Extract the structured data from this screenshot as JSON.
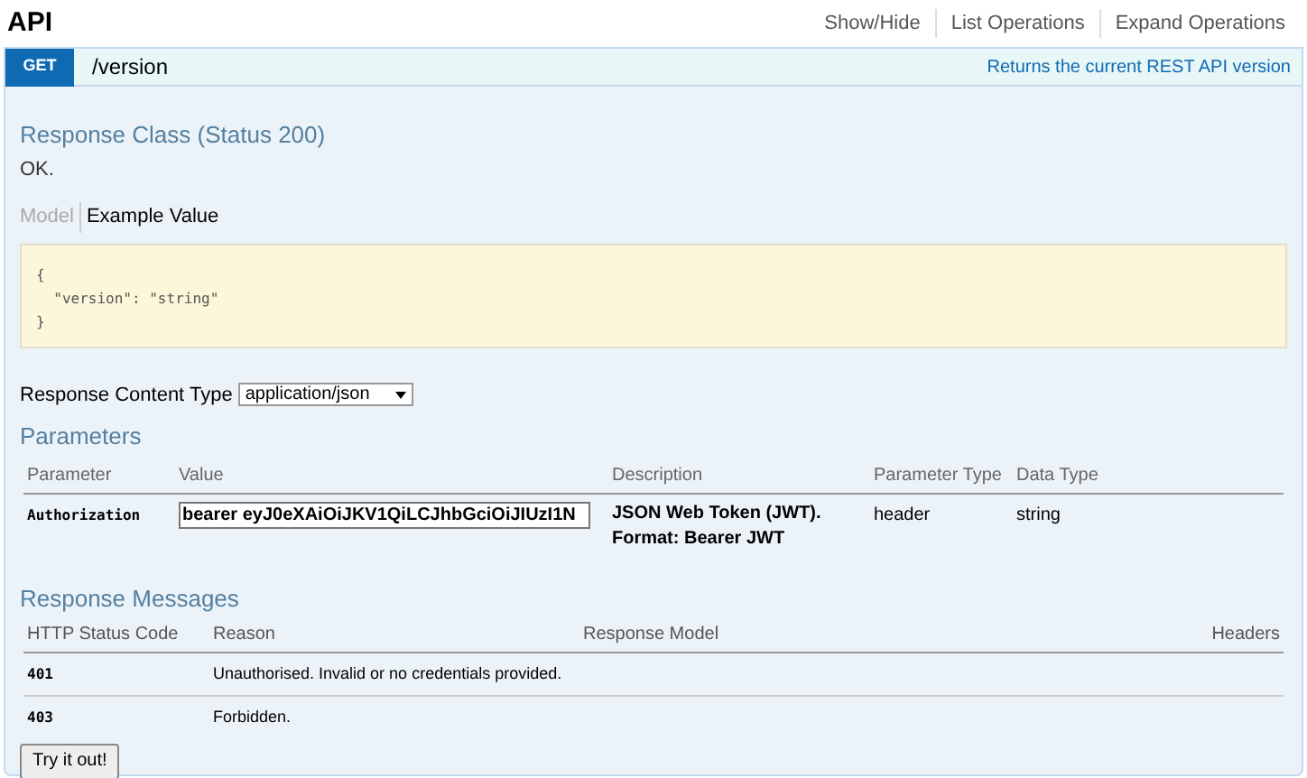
{
  "heading": "API",
  "header_links": [
    "Show/Hide",
    "List Operations",
    "Expand Operations"
  ],
  "operation": {
    "method": "GET",
    "path": "/version",
    "summary": "Returns the current REST API version"
  },
  "response_class": {
    "title": "Response Class (Status 200)",
    "description": "OK."
  },
  "model_tabs": [
    {
      "label": "Model",
      "selected": false
    },
    {
      "label": "Example Value",
      "selected": true
    }
  ],
  "example_lines": [
    "{",
    "  \"version\": \"string\"",
    "}"
  ],
  "response_content_type": {
    "label": "Response Content Type",
    "value": "application/json"
  },
  "parameters": {
    "title": "Parameters",
    "columns": [
      "Parameter",
      "Value",
      "Description",
      "Parameter Type",
      "Data Type"
    ],
    "rows": [
      {
        "name": "Authorization",
        "value": "bearer eyJ0eXAiOiJKV1QiLCJhbGciOiJIUzI1N",
        "description": [
          "JSON Web Token (JWT).",
          "Format: Bearer JWT"
        ],
        "param_type": "header",
        "data_type": "string"
      }
    ]
  },
  "response_messages": {
    "title": "Response Messages",
    "columns": [
      "HTTP Status Code",
      "Reason",
      "Response Model",
      "Headers"
    ],
    "rows": [
      {
        "code": "401",
        "reason": "Unauthorised. Invalid or no credentials provided."
      },
      {
        "code": "403",
        "reason": "Forbidden."
      }
    ]
  },
  "try_button": "Try it out!"
}
